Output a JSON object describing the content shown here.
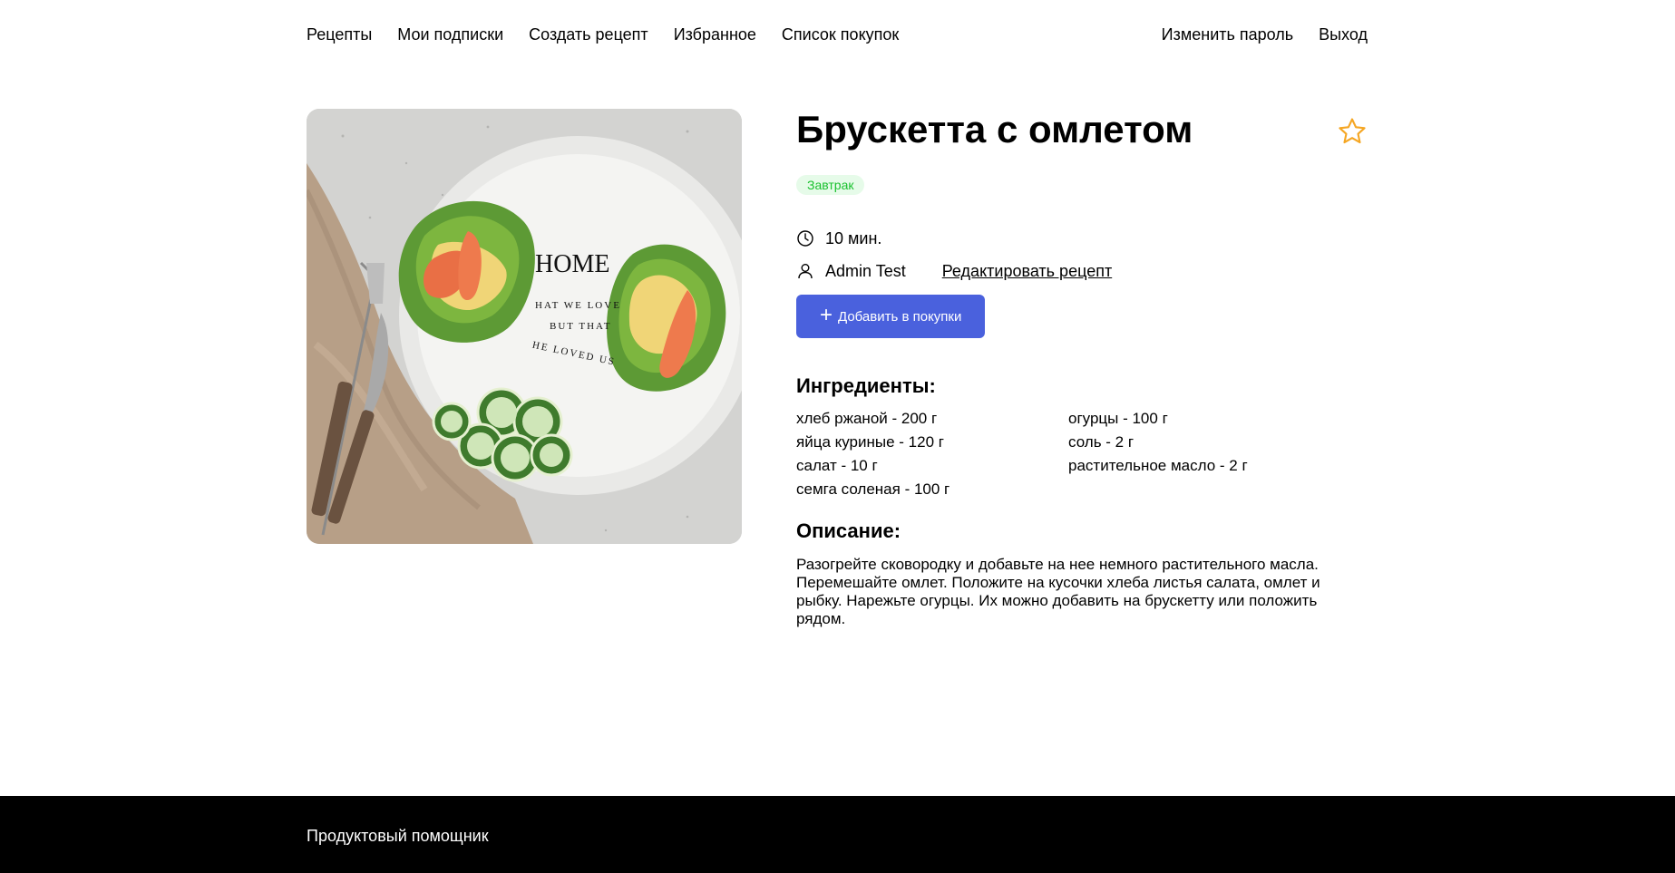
{
  "nav": {
    "left": [
      "Рецепты",
      "Мои подписки",
      "Создать рецепт",
      "Избранное",
      "Список покупок"
    ],
    "right": [
      "Изменить пароль",
      "Выход"
    ]
  },
  "recipe": {
    "title": "Брускетта с омлетом",
    "tag": "Завтрак",
    "time": "10 мин.",
    "author": "Admin Test",
    "edit_label": "Редактировать рецепт",
    "add_to_cart_label": "Добавить в покупки",
    "ingredients_title": "Ингредиенты:",
    "ingredients": [
      "хлеб ржаной - 200 г",
      "яйца куриные - 120 г",
      "салат - 10 г",
      "семга соленая - 100 г",
      "огурцы - 100 г",
      "соль - 2 г",
      "растительное масло - 2 г"
    ],
    "description_title": "Описание:",
    "description": "Разогрейте сковородку и добавьте на нее немного растительного масла. Перемешайте омлет. Положите на кусочки хлеба листья салата, омлет и рыбку. Нарежьте огурцы. Их можно добавить на брускетту или положить рядом.",
    "plate_text": {
      "word": "HOME",
      "line1": "HAT WE LOVE",
      "line2": "BUT THAT",
      "line3": "HE LOVED US"
    }
  },
  "footer": {
    "text": "Продуктовый помощник"
  },
  "icons": {
    "favorite": "star-outline-icon",
    "time": "clock-icon",
    "author": "user-icon",
    "add": "plus-icon"
  },
  "colors": {
    "accent": "#4a61dd",
    "tag_bg": "#e6fbe9",
    "tag_text": "#19c12e",
    "star": "#f5a623",
    "footer_bg": "#000000"
  }
}
